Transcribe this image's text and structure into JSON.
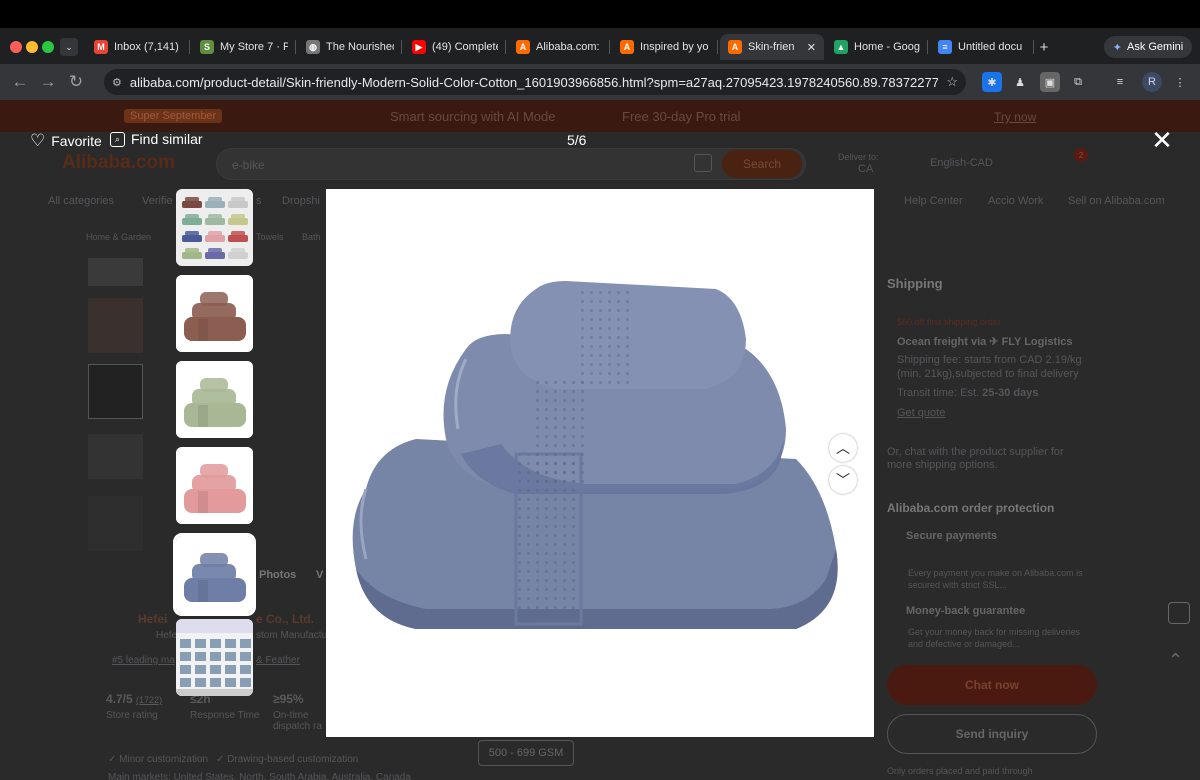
{
  "browser": {
    "tabs": [
      {
        "label": "Inbox (7,141)",
        "icon": "gmail-icon",
        "color": "#ea4335"
      },
      {
        "label": "My Store 7 · Pa",
        "icon": "shopify-icon",
        "color": "#5e8e3e"
      },
      {
        "label": "The Nourished",
        "icon": "globe-icon",
        "color": "#777"
      },
      {
        "label": "(49) Complete",
        "icon": "youtube-icon",
        "color": "#ff0000"
      },
      {
        "label": "Alibaba.com: I",
        "icon": "alibaba-icon",
        "color": "#ff6a00"
      },
      {
        "label": "Inspired by yo",
        "icon": "alibaba-icon",
        "color": "#ff6a00"
      },
      {
        "label": "Skin-frien",
        "icon": "alibaba-icon",
        "color": "#ff6a00"
      },
      {
        "label": "Home - Googl",
        "icon": "drive-icon",
        "color": "#1fa463"
      },
      {
        "label": "Untitled docu",
        "icon": "docs-icon",
        "color": "#4285f4"
      }
    ],
    "new_tab": "+",
    "gemini": "Ask Gemini",
    "url": "alibaba.com/product-detail/Skin-friendly-Modern-Solid-Color-Cotton_1601903966856.html?spm=a27aq.27095423.1978240560.89.78372277IdP...",
    "profile": "R"
  },
  "background": {
    "promo_badge": "Super September",
    "promo_text": "Smart sourcing with AI Mode",
    "promo_trial": "Free 30-day Pro trial",
    "promo_cta": "Try now",
    "logo": "Alibaba.com",
    "search_placeholder": "e-bike",
    "search_btn": "Search",
    "deliver_to": "Deliver to:",
    "country": "CA",
    "language": "English-CAD",
    "cart_count": "2",
    "nav": [
      "All categories",
      "Verifie",
      "s",
      "Dropshi"
    ],
    "nav_right": [
      "Help Center",
      "Accio Work",
      "Sell on Alibaba.com"
    ],
    "crumbs": [
      "Home & Garden",
      "Towels",
      "Bath"
    ],
    "photos_label": "Photos",
    "videos_label": "V",
    "company": "Hefei",
    "company_suffix": "e Co., Ltd.",
    "location": "Hefe",
    "manuf": "stom Manufactu",
    "leading": "#5 leading ma",
    "feather": "& Feather",
    "stats": [
      {
        "value": "4.7/5",
        "extra": "(1722)",
        "label": "Store rating"
      },
      {
        "value": "≤2h",
        "extra": "",
        "label": "Response Time"
      },
      {
        "value": "≥95%",
        "extra": "",
        "label": "On-time dispatch ra"
      }
    ],
    "customization": [
      "Minor customization",
      "Drawing-based customization"
    ],
    "gsm": "500 - 699 GSM",
    "shipping_title": "Shipping",
    "coupon": "$60 off first shipping order",
    "logistics": "Ocean freight via ✈ FLY Logistics",
    "fee": "Shipping fee: starts from CAD 2.19/kg (min. 21kg),subjected to final delivery",
    "transit_label": "Transit time: Est.",
    "transit": "25-30 days",
    "quote": "Get quote",
    "chat_more": "Or, chat with the product supplier for more shipping options.",
    "protection": "Alibaba.com order protection",
    "secure": "Secure payments",
    "secure_desc": "Every payment you make on Alibaba.com is secured with strict SSL...",
    "money_back": "Money-back guarantee",
    "money_desc": "Get your money back for missing deliveries and defective or damaged...",
    "chat_now": "Chat now",
    "inquiry": "Send inquiry",
    "footer_note": "Only orders placed and paid through",
    "bottom_text": "Main markets: United States, North, South Arabia, Australia, Canada"
  },
  "viewer": {
    "favorite": "Favorite",
    "find_similar": "Find similar",
    "counter": "5/6",
    "thumbnails": [
      {
        "name": "thumb-color-grid",
        "kind": "grid"
      },
      {
        "name": "thumb-brown-towels",
        "color": "#8c5e52"
      },
      {
        "name": "thumb-sage-towels",
        "color": "#a8b894"
      },
      {
        "name": "thumb-pink-towels",
        "color": "#e29a9a"
      },
      {
        "name": "thumb-blue-towels",
        "color": "#6e7ea6",
        "selected": true
      },
      {
        "name": "thumb-factory",
        "kind": "factory"
      }
    ],
    "main_color": "#7684a6"
  }
}
